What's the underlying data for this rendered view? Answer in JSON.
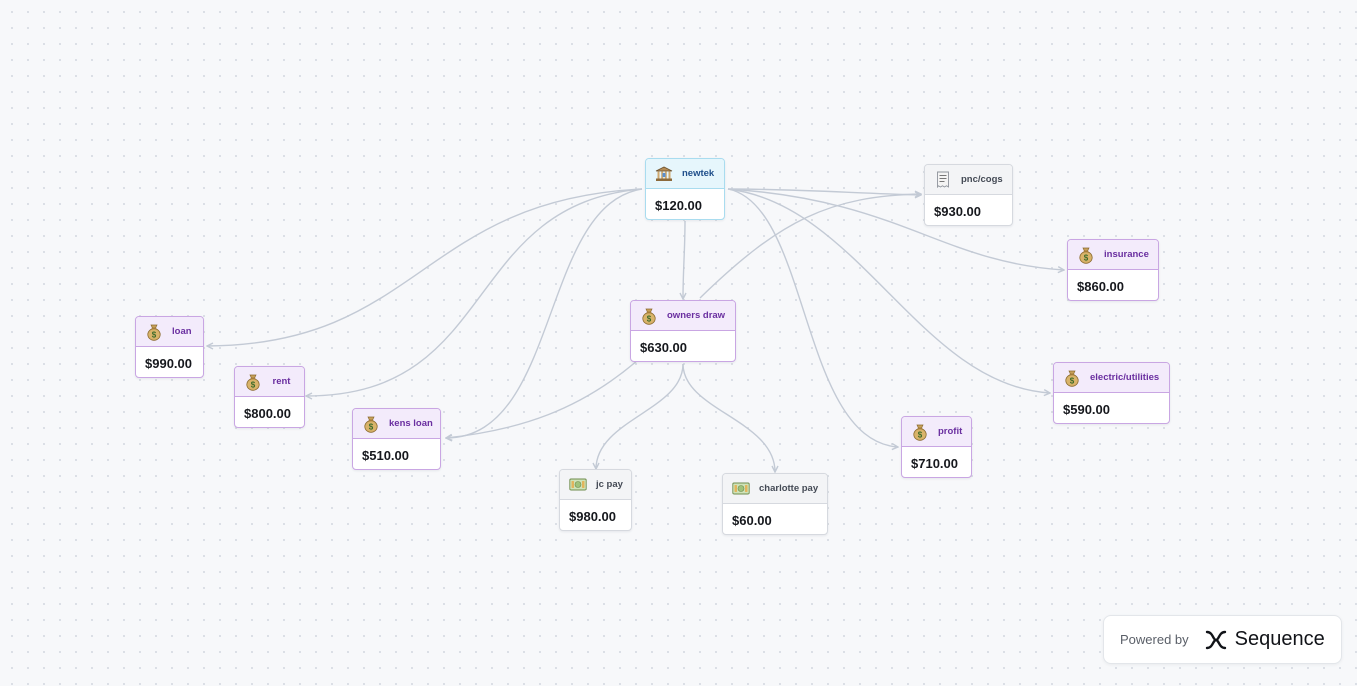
{
  "nodes": [
    {
      "id": "newtek",
      "label": "newtek",
      "amount": "$120.00",
      "icon": "bank-icon",
      "color": "blue"
    },
    {
      "id": "pnc",
      "label": "pnc/cogs",
      "amount": "$930.00",
      "icon": "receipt-icon",
      "color": "gray"
    },
    {
      "id": "insurance",
      "label": "insurance",
      "amount": "$860.00",
      "icon": "money-bag-icon",
      "color": "purple"
    },
    {
      "id": "owners",
      "label": "owners draw",
      "amount": "$630.00",
      "icon": "money-bag-icon",
      "color": "purple"
    },
    {
      "id": "loan",
      "label": "loan",
      "amount": "$990.00",
      "icon": "money-bag-icon",
      "color": "purple"
    },
    {
      "id": "rent",
      "label": "rent",
      "amount": "$800.00",
      "icon": "money-bag-icon",
      "color": "purple"
    },
    {
      "id": "kens",
      "label": "kens loan",
      "amount": "$510.00",
      "icon": "money-bag-icon",
      "color": "purple"
    },
    {
      "id": "electric",
      "label": "electric/utilities",
      "amount": "$590.00",
      "icon": "money-bag-icon",
      "color": "purple"
    },
    {
      "id": "profit",
      "label": "profit",
      "amount": "$710.00",
      "icon": "money-bag-icon",
      "color": "purple"
    },
    {
      "id": "jc",
      "label": "jc pay",
      "amount": "$980.00",
      "icon": "dollar-bill-icon",
      "color": "gray"
    },
    {
      "id": "charlotte",
      "label": "charlotte pay",
      "amount": "$60.00",
      "icon": "dollar-bill-icon",
      "color": "gray"
    }
  ],
  "edges": [
    {
      "from": "newtek",
      "to": "pnc"
    },
    {
      "from": "newtek",
      "to": "insurance"
    },
    {
      "from": "newtek",
      "to": "electric"
    },
    {
      "from": "newtek",
      "to": "profit"
    },
    {
      "from": "newtek",
      "to": "owners"
    },
    {
      "from": "newtek",
      "to": "loan"
    },
    {
      "from": "newtek",
      "to": "rent"
    },
    {
      "from": "newtek",
      "to": "kens"
    },
    {
      "from": "owners",
      "to": "pnc"
    },
    {
      "from": "owners",
      "to": "kens"
    },
    {
      "from": "owners",
      "to": "jc"
    },
    {
      "from": "owners",
      "to": "charlotte"
    }
  ],
  "footer": {
    "powered_by": "Powered by",
    "brand": "Sequence",
    "brand_icon": "sequence-logo-icon"
  },
  "colors": {
    "purple_header": "#f3ebfb",
    "purple_border": "#c9a6e3",
    "blue_header": "#e6f6fc",
    "blue_border": "#a9dcef",
    "edge": "#c3cad5"
  }
}
